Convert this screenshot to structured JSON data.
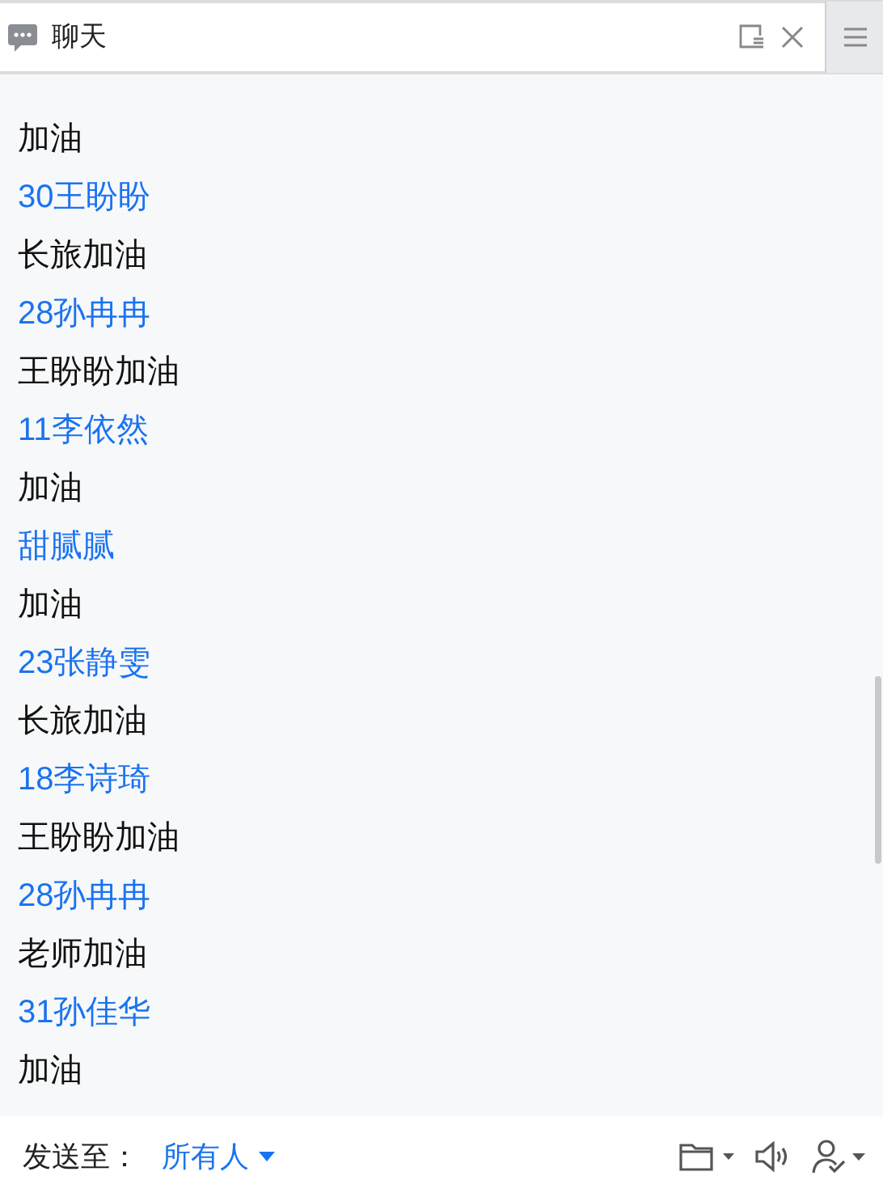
{
  "window": {
    "title": "聊天"
  },
  "messages": [
    {
      "text": "加油"
    },
    {
      "sender": "30王盼盼",
      "text": "长旅加油"
    },
    {
      "sender": "28孙冉冉",
      "text": "王盼盼加油"
    },
    {
      "sender": "11李依然",
      "text": "加油"
    },
    {
      "sender": "甜腻腻",
      "text": "加油"
    },
    {
      "sender": "23张静雯",
      "text": "长旅加油"
    },
    {
      "sender": "18李诗琦",
      "text": "王盼盼加油"
    },
    {
      "sender": "28孙冉冉",
      "text": "老师加油"
    },
    {
      "sender": "31孙佳华",
      "text": "加油"
    }
  ],
  "send_to": {
    "label": "发送至：",
    "target": "所有人"
  }
}
